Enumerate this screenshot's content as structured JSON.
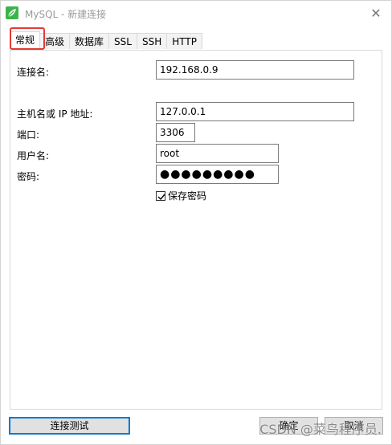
{
  "window": {
    "title": "MySQL - 新建连接",
    "close_glyph": "✕"
  },
  "tabs": [
    {
      "label": "常规",
      "active": true
    },
    {
      "label": "高级",
      "active": false
    },
    {
      "label": "数据库",
      "active": false
    },
    {
      "label": "SSL",
      "active": false
    },
    {
      "label": "SSH",
      "active": false
    },
    {
      "label": "HTTP",
      "active": false
    }
  ],
  "form": {
    "connection_name": {
      "label": "连接名:",
      "value": "192.168.0.9"
    },
    "host": {
      "label": "主机名或 IP 地址:",
      "value": "127.0.0.1"
    },
    "port": {
      "label": "端口:",
      "value": "3306"
    },
    "username": {
      "label": "用户名:",
      "value": "root"
    },
    "password": {
      "label": "密码:",
      "value": "●●●●●●●●●"
    },
    "save_password": {
      "label": "保存密码",
      "checked": true
    }
  },
  "buttons": {
    "test_connection": "连接测试",
    "ok": "确定",
    "cancel": "取消"
  },
  "watermark": "CSDN @菜鸟程序员.",
  "colors": {
    "accent": "#0078d7",
    "highlight": "#e53935",
    "app_icon": "#3cb44b"
  },
  "icons": {
    "app": "mysql-leaf-icon",
    "close": "close-icon",
    "check": "checkmark-icon"
  }
}
